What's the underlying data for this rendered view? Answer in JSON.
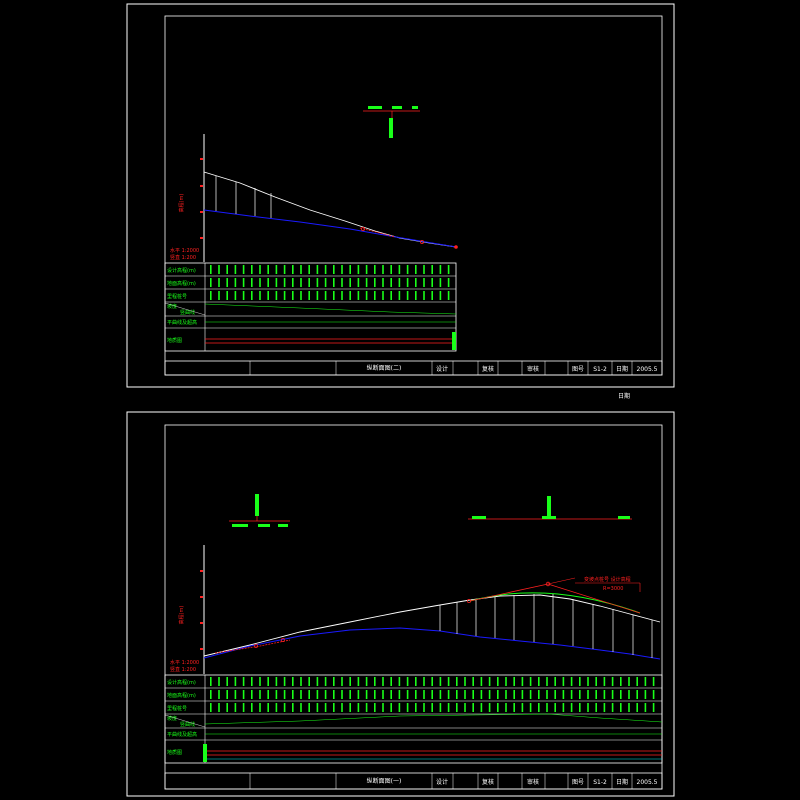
{
  "colors": {
    "background": "#000000",
    "frame": "#ffffff",
    "ground_line": "#ffffff",
    "design_line": "#1a1aff",
    "text_green": "#19ff19",
    "text_red": "#ff2020",
    "text_white": "#ffffff",
    "cyan": "#00e5e5"
  },
  "between_sheets_label": "日期",
  "sheets": [
    {
      "title": "纵断面图(二)",
      "title_block": {
        "design": "设计",
        "review": "复核",
        "audit": "审核",
        "drawing_no_label": "图号",
        "drawing_no": "S1-2",
        "date_label": "日期",
        "date": "2005.5"
      },
      "row_labels": [
        "设计高程(m)",
        "地面高程(m)",
        "里程桩号",
        "坡度",
        "竖曲线",
        "平曲线及超高",
        "地质图"
      ],
      "vertical_axis_label": "高程(m)",
      "scale_note": [
        "水平 1:2000",
        "竖直 1:200"
      ]
    },
    {
      "title": "纵断面图(一)",
      "title_block": {
        "design": "设计",
        "review": "复核",
        "audit": "审核",
        "drawing_no_label": "图号",
        "drawing_no": "S1-2",
        "date_label": "日期",
        "date": "2005.5"
      },
      "row_labels": [
        "设计高程(m)",
        "地面高程(m)",
        "里程桩号",
        "坡度",
        "竖曲线",
        "平曲线及超高",
        "地质图"
      ],
      "vertical_axis_label": "高程(m)",
      "scale_note": [
        "水平 1:2000",
        "竖直 1:200"
      ],
      "callout": [
        "变坡点桩号 设计高程",
        "R=3000"
      ]
    }
  ]
}
